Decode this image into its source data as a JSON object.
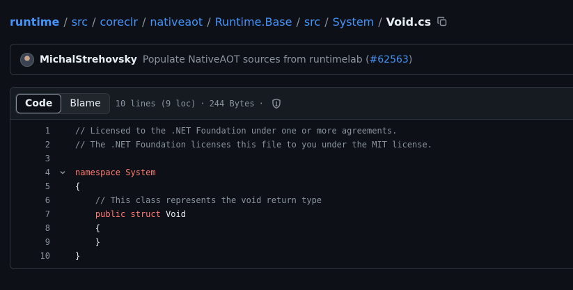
{
  "breadcrumb": {
    "items": [
      "runtime",
      "src",
      "coreclr",
      "nativeaot",
      "Runtime.Base",
      "src",
      "System"
    ],
    "separator": "/",
    "current_file": "Void.cs"
  },
  "commit": {
    "author": "MichalStrehovsky",
    "message_prefix": "Populate NativeAOT sources from runtimelab (",
    "pr_link": "#62563",
    "message_suffix": ")"
  },
  "file_header": {
    "tab_code": "Code",
    "tab_blame": "Blame",
    "lines_info": "10 lines (9 loc)",
    "size_info": "244 Bytes",
    "separator": "·"
  },
  "code_lines": [
    {
      "num": "1",
      "tokens": [
        {
          "t": "comment",
          "v": "// Licensed to the .NET Foundation under one or more agreements."
        }
      ]
    },
    {
      "num": "2",
      "tokens": [
        {
          "t": "comment",
          "v": "// The .NET Foundation licenses this file to you under the MIT license."
        }
      ]
    },
    {
      "num": "3",
      "tokens": []
    },
    {
      "num": "4",
      "fold": true,
      "tokens": [
        {
          "t": "kw",
          "v": "namespace"
        },
        {
          "t": "text",
          "v": " "
        },
        {
          "t": "kw",
          "v": "System"
        }
      ]
    },
    {
      "num": "5",
      "tokens": [
        {
          "t": "text",
          "v": "{"
        }
      ]
    },
    {
      "num": "6",
      "tokens": [
        {
          "t": "text",
          "v": "    "
        },
        {
          "t": "comment",
          "v": "// This class represents the void return type"
        }
      ]
    },
    {
      "num": "7",
      "tokens": [
        {
          "t": "text",
          "v": "    "
        },
        {
          "t": "kw",
          "v": "public"
        },
        {
          "t": "text",
          "v": " "
        },
        {
          "t": "kw",
          "v": "struct"
        },
        {
          "t": "text",
          "v": " Void"
        }
      ]
    },
    {
      "num": "8",
      "tokens": [
        {
          "t": "text",
          "v": "    {"
        }
      ]
    },
    {
      "num": "9",
      "tokens": [
        {
          "t": "text",
          "v": "    }"
        }
      ]
    },
    {
      "num": "10",
      "tokens": [
        {
          "t": "text",
          "v": "}"
        }
      ]
    }
  ],
  "icons": {
    "copy": "copy-icon",
    "shield": "shield-icon",
    "fold": "chevron-down-icon"
  },
  "colors": {
    "link": "#4493f8",
    "keyword": "#ff7b72",
    "comment": "#8b949e",
    "background": "#0d1117"
  }
}
